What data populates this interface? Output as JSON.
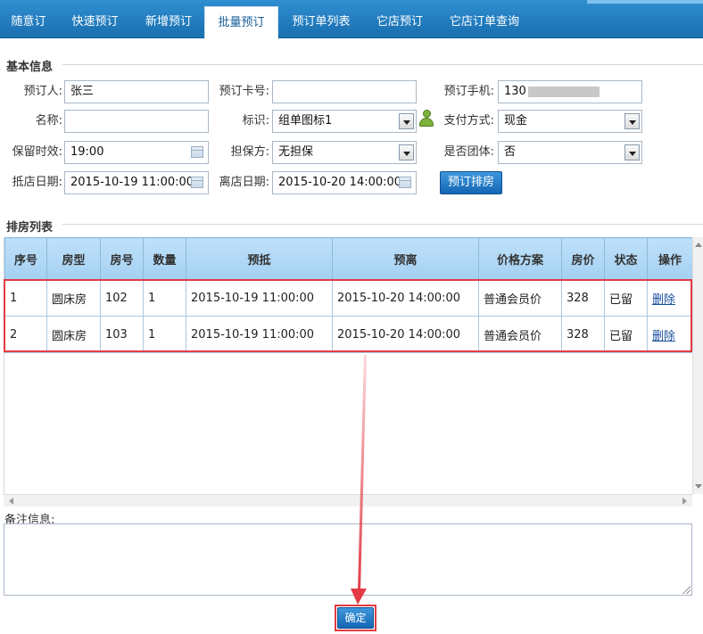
{
  "tabs": [
    {
      "label": "随意订"
    },
    {
      "label": "快速预订"
    },
    {
      "label": "新增预订"
    },
    {
      "label": "批量预订"
    },
    {
      "label": "预订单列表"
    },
    {
      "label": "它店预订"
    },
    {
      "label": "它店订单查询"
    }
  ],
  "basic_info": {
    "legend": "基本信息",
    "booker_label": "预订人:",
    "booker_value": "张三",
    "card_label": "预订卡号:",
    "card_value": "",
    "phone_label": "预订手机:",
    "phone_value": "130",
    "name_label": "名称:",
    "name_value": "",
    "mark_label": "标识:",
    "mark_value": "组单图标1",
    "mark_icon": "person-icon",
    "payment_label": "支付方式:",
    "payment_value": "现金",
    "hold_label": "保留时效:",
    "hold_value": "19:00",
    "guarantee_label": "担保方:",
    "guarantee_value": "无担保",
    "group_label": "是否团体:",
    "group_value": "否",
    "arrive_label": "抵店日期:",
    "arrive_value": "2015-10-19 11:00:00",
    "depart_label": "离店日期:",
    "depart_value": "2015-10-20 14:00:00",
    "arrange_button": "预订排房"
  },
  "room_list": {
    "legend": "排房列表",
    "headers": [
      "序号",
      "房型",
      "房号",
      "数量",
      "预抵",
      "预离",
      "价格方案",
      "房价",
      "状态",
      "操作"
    ],
    "rows": [
      {
        "no": "1",
        "type": "圆床房",
        "room": "102",
        "qty": "1",
        "arrive": "2015-10-19 11:00:00",
        "depart": "2015-10-20 14:00:00",
        "plan": "普通会员价",
        "price": "328",
        "status": "已留",
        "action": "删除"
      },
      {
        "no": "2",
        "type": "圆床房",
        "room": "103",
        "qty": "1",
        "arrive": "2015-10-19 11:00:00",
        "depart": "2015-10-20 14:00:00",
        "plan": "普通会员价",
        "price": "328",
        "status": "已留",
        "action": "删除"
      }
    ]
  },
  "remark": {
    "label": "备注信息:",
    "value": ""
  },
  "confirm_button": "确定",
  "colors": {
    "tab_bar": "#1a6fb0",
    "highlight": "#e23b45",
    "button": "#1566b4",
    "header": "#a4d0f2"
  }
}
